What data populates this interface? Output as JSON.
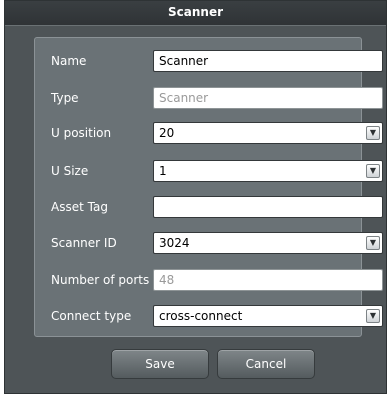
{
  "dialog": {
    "title": "Scanner"
  },
  "form": {
    "name": {
      "label": "Name",
      "value": "Scanner"
    },
    "type": {
      "label": "Type",
      "value": "Scanner"
    },
    "u_position": {
      "label": "U position",
      "value": "20"
    },
    "u_size": {
      "label": "U Size",
      "value": "1"
    },
    "asset_tag": {
      "label": "Asset Tag",
      "value": ""
    },
    "scanner_id": {
      "label": "Scanner ID",
      "value": "3024"
    },
    "number_of_ports": {
      "label": "Number of ports",
      "value": "48"
    },
    "connect_type": {
      "label": "Connect type",
      "value": "cross-connect"
    }
  },
  "buttons": {
    "save": "Save",
    "cancel": "Cancel"
  },
  "icons": {
    "dropdown": "chevron-down-icon"
  }
}
